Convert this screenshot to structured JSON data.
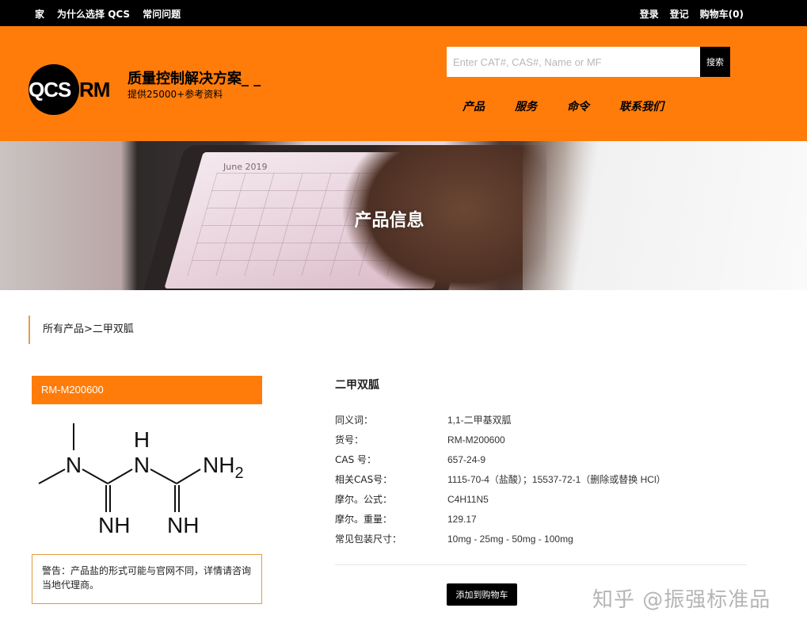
{
  "topbar": {
    "nav_left": [
      "家",
      "为什么选择 QCS",
      "常问问题"
    ],
    "login": "登录",
    "register": "登记",
    "cart": "购物车(0)"
  },
  "header": {
    "logo_qcs": "QCS",
    "logo_rm": "RM",
    "brand_title": "质量控制解决方案_ _",
    "brand_subtitle": "提供25000+参考资料",
    "search_placeholder": "Enter CAT#, CAS#, Name or MF",
    "search_button": "搜索",
    "nav": [
      "产品",
      "服务",
      "命令",
      "联系我们"
    ]
  },
  "banner": {
    "title": "产品信息",
    "calendar_label": "June 2019"
  },
  "breadcrumb": {
    "root": "所有产品",
    "separator": ">",
    "current": "二甲双胍"
  },
  "product": {
    "sku": "RM-M200600",
    "structure_labels": [
      "N",
      "H",
      "N",
      "NH2",
      "NH",
      "NH"
    ],
    "warning": "警告：产品盐的形式可能与官网不同，详情请咨询当地代理商。",
    "name": "二甲双胍",
    "specs": [
      {
        "label": "同义词：",
        "value": "1,1-二甲基双胍"
      },
      {
        "label": "货号：",
        "value": "RM-M200600"
      },
      {
        "label": "CAS 号：",
        "value": "657-24-9"
      },
      {
        "label": "相关CAS号：",
        "value": "1115-70-4（盐酸）；15537-72-1（删除或替换 HCl）"
      },
      {
        "label": "摩尔。公式：",
        "value": "C4H11N5"
      },
      {
        "label": "摩尔。重量：",
        "value": "129.17"
      },
      {
        "label": "常见包装尺寸：",
        "value": "10mg - 25mg - 50mg - 100mg"
      }
    ],
    "add_to_cart": "添加到购物车"
  },
  "watermark": "知乎 @振强标准品",
  "colors": {
    "accent": "#ff7c0a",
    "topbar": "#000000"
  }
}
